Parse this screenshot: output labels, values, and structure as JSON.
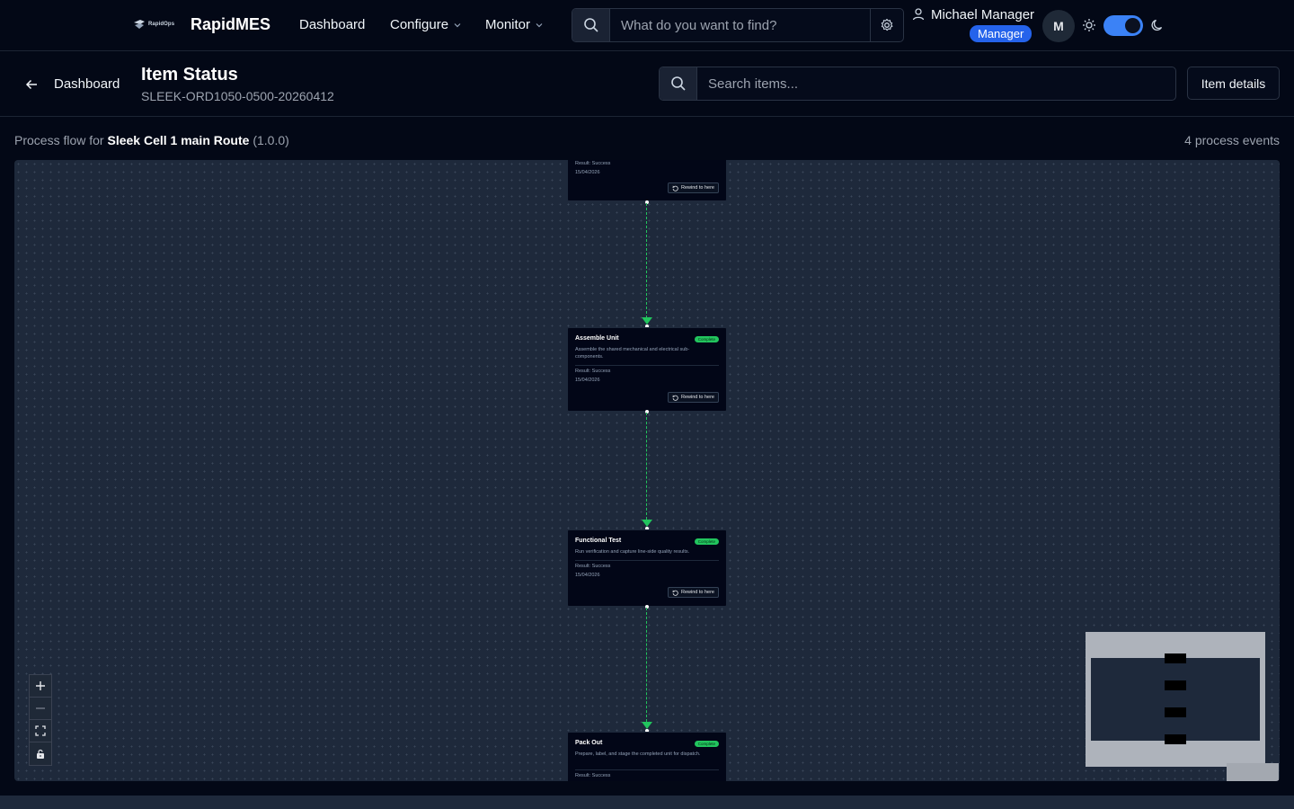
{
  "nav": {
    "logo_text": "RapidOps",
    "app_name": "RapidMES",
    "links": [
      {
        "label": "Dashboard"
      },
      {
        "label": "Configure"
      },
      {
        "label": "Monitor"
      }
    ],
    "search_placeholder": "What do you want to find?",
    "user_name": "Michael Manager",
    "user_role": "Manager",
    "avatar_initial": "M",
    "theme": "dark"
  },
  "header": {
    "back_label": "Dashboard",
    "title": "Item Status",
    "item_id": "SLEEK-ORD1050-0500-20260412",
    "search_placeholder": "Search items...",
    "details_label": "Item details"
  },
  "flow": {
    "prefix": "Process flow for",
    "route_name": "Sleek Cell 1 main Route",
    "version": "(1.0.0)",
    "event_count": "4 process events"
  },
  "nodes": [
    {
      "title": "",
      "badge": "",
      "description": "",
      "result": "Result: Success",
      "date": "15/04/2026",
      "action": "Rewind to here"
    },
    {
      "title": "Assemble Unit",
      "badge": "Complete",
      "description": "Assemble the shared mechanical and electrical sub-components.",
      "result": "Result: Success",
      "date": "15/04/2026",
      "action": "Rewind to here"
    },
    {
      "title": "Functional Test",
      "badge": "Complete",
      "description": "Run verification and capture line-side quality results.",
      "result": "Result: Success",
      "date": "15/04/2026",
      "action": "Rewind to here"
    },
    {
      "title": "Pack Out",
      "badge": "Complete",
      "description": "Prepare, label, and stage the completed unit for dispatch.",
      "result": "Result: Success",
      "date": "",
      "action": ""
    }
  ],
  "colors": {
    "accent": "#3b82f6",
    "success": "#22c55e",
    "background": "#030816",
    "canvas": "#1e293b"
  }
}
